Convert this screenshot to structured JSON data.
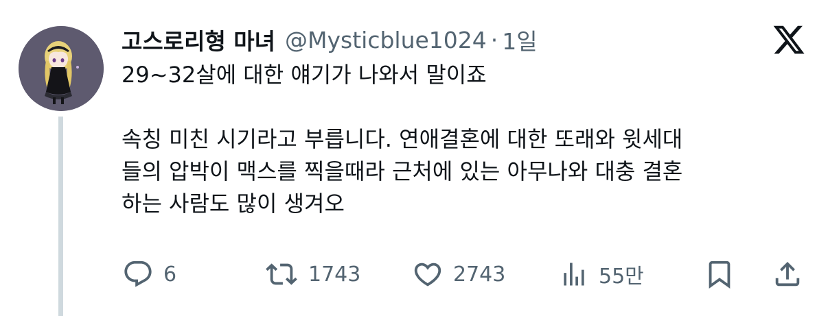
{
  "tweet": {
    "display_name": "고스로리형 마녀",
    "handle": "@Mysticblue1024",
    "separator": "·",
    "time": "1일",
    "text_lines": [
      "29~32살에 대한 얘기가 나와서 말이죠",
      "",
      "속칭 미친 시기라고 부릅니다. 연애결혼에 대한 또래와 윗세대",
      "들의 압박이 맥스를 찍을때라 근처에 있는 아무나와 대충 결혼",
      "하는 사람도 많이 생겨오"
    ]
  },
  "actions": {
    "reply": {
      "icon": "reply-icon",
      "count": "6"
    },
    "retweet": {
      "icon": "retweet-icon",
      "count": "1743"
    },
    "like": {
      "icon": "heart-icon",
      "count": "2743"
    },
    "views": {
      "icon": "views-chart-icon",
      "count": "55만"
    },
    "bookmark": {
      "icon": "bookmark-icon"
    },
    "share": {
      "icon": "share-icon"
    }
  },
  "colors": {
    "text": "#0f1419",
    "secondary": "#536471",
    "thread_line": "#cfd9de",
    "avatar_bg": "#5e5a6f"
  },
  "logo": "x-logo-icon"
}
